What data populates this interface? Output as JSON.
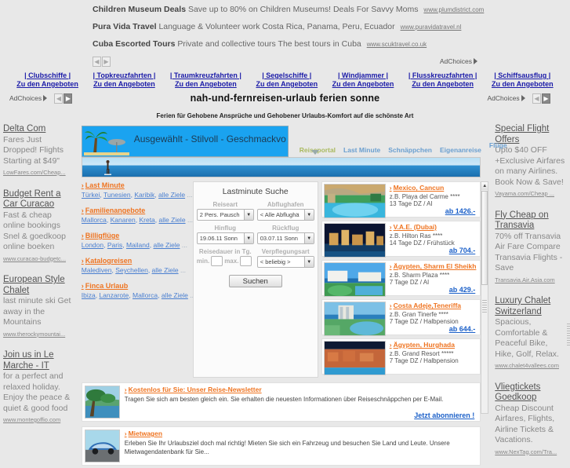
{
  "top_ads": [
    {
      "title": "Children Museum Deals",
      "text": "Save up to 80% on Children Museums! Deals For Savvy Moms",
      "url": "www.plumdistrict.com"
    },
    {
      "title": "Pura Vida Travel",
      "text": "Language & Volunteer work Costa Rica, Panama, Peru, Ecuador",
      "url": "www.puravidatravel.nl"
    },
    {
      "title": "Cuba Escorted Tours",
      "text": "Private and collective tours The best tours in Cuba",
      "url": "www.scuktravel.co.uk"
    }
  ],
  "adchoices_label": "AdChoices",
  "blue_links": [
    {
      "top": "| Clubschiffe |",
      "bottom": "Zu den Angeboten"
    },
    {
      "top": "| Topkreuzfahrten |",
      "bottom": "Zu den Angeboten"
    },
    {
      "top": "| Traumkreuzfahrten |",
      "bottom": "Zu den Angeboten"
    },
    {
      "top": "| Segelschiffe |",
      "bottom": "Zu den Angeboten"
    },
    {
      "top": "| Windjammer |",
      "bottom": "Zu den Angeboten"
    },
    {
      "top": "| Flusskreuzfahrten |",
      "bottom": "Zu den Angeboten"
    },
    {
      "top": "| Schiffsausflug |",
      "bottom": "Zu den Angeboten"
    }
  ],
  "site": {
    "title": "nah-und-fernreisen-urlaub ferien sonne",
    "subtitle": "Ferien für Gehobene Ansprüche und Gehobener Urlaubs-Komfort auf die schönste Art"
  },
  "left_sidebar": [
    {
      "heading": "Delta Com",
      "desc": "Fares Just Dropped! Flights Starting at $49\"",
      "url": "LowFares.com/Cheap..."
    },
    {
      "heading": "Budget Rent a Car Curacao",
      "desc": "Fast & cheap online bookings Snel & goedkoop online boeken",
      "url": "www.curacao-budgetc..."
    },
    {
      "heading": "European Style Chalet",
      "desc": "last minute ski Get away in the Mountains",
      "url": "www.therockymountai..."
    },
    {
      "heading": "Join us in Le Marche - IT",
      "desc": "for a perfect and relaxed holiday. Enjoy the peace & quiet & good food",
      "url": "www.montegoffio.com"
    }
  ],
  "right_sidebar": [
    {
      "heading": "Special Flight Offers",
      "desc": "Upto $40 OFF +Exclusive Airfares on many Airlines. Book Now & Save!",
      "url": "Vayama.com/Cheap  ..."
    },
    {
      "heading": "Fly Cheap on Transavia",
      "desc": "70% off Transavia Air Fare Compare Transavia Flights - Save",
      "url": "Transavia.Air.Asia.com"
    },
    {
      "heading": "Luxury Chalet Switzerland",
      "desc": "Spacious, Comfortable & Peaceful Bike, Hike, Golf, Relax.",
      "url": "www.chalet4vallees.com"
    },
    {
      "heading": "Vliegtickets Goedkoop",
      "desc": "Cheap Discount Airfares, Flights, Airline Tickets & Vacations.",
      "url": "www.NexTag.com/Tra..."
    }
  ],
  "banner": {
    "text": "Ausgewählt - Stilvoll - Geschmackvo"
  },
  "nav_tabs": [
    {
      "label": "Reiseportal",
      "active": true
    },
    {
      "label": "Last Minute",
      "active": false
    },
    {
      "label": "Schnäppchen",
      "active": false
    },
    {
      "label": "Eigenanreise",
      "active": false
    },
    {
      "label": "Flüge",
      "active": false
    }
  ],
  "left_links": [
    {
      "head": "Last Minute",
      "subs": [
        "Türkei",
        "Tunesien",
        "Karibik",
        "alle Ziele"
      ]
    },
    {
      "head": "Familienangebote",
      "subs": [
        "Mallorca",
        "Kanaren",
        "Kreta",
        "alle Ziele"
      ]
    },
    {
      "head": "Billigflüge",
      "subs": [
        "London",
        "Paris",
        "Mailand",
        "alle Ziele"
      ]
    },
    {
      "head": "Katalogreisen",
      "subs": [
        "Malediven",
        "Seychellen",
        "alle Ziele"
      ]
    },
    {
      "head": "Finca Urlaub",
      "subs": [
        "Ibiza",
        "Lanzarote",
        "Mallorca",
        "alle Ziele"
      ]
    }
  ],
  "search_form": {
    "title": "Lastminute Suche",
    "labels": {
      "reiseart": "Reiseart",
      "abflughafen": "Abflughafen",
      "hinflug": "Hinflug",
      "rueckflug": "Rückflug",
      "reisedauer": "Reisedauer in Tg.",
      "verpflegung": "Verpflegungsart",
      "min": "min.",
      "max": "max."
    },
    "values": {
      "reiseart": "2 Pers. Pausch",
      "abflughafen": "< Alle Abflughä",
      "hinflug": "19.06.11 Sonn",
      "rueckflug": "03.07.11 Sonn",
      "min": "",
      "max": "",
      "verpflegung": "< beliebig >"
    },
    "submit": "Suchen"
  },
  "offers": [
    {
      "title": "Mexico, Cancun",
      "line1": "z.B. Playa del Carme ****",
      "line2": "13 Tage DZ / AI",
      "price": "ab 1426.-"
    },
    {
      "title": "V.A.E. (Dubai)",
      "line1": "z.B. Hilton Ras ****",
      "line2": "14 Tage DZ / Frühstück",
      "price": "ab 704.-"
    },
    {
      "title": "Ägypten, Sharm El Sheikh",
      "line1": "z.B. Sharm Plaza ****",
      "line2": "7 Tage DZ / AI",
      "price": "ab 429.-"
    },
    {
      "title": "Costa Adeje,Teneriffa",
      "line1": "z.B. Gran Tinerfe ****",
      "line2": "7 Tage DZ / Halbpension",
      "price": "ab 644.-"
    },
    {
      "title": "Ägypten, Hurghada",
      "line1": "z.B. Grand Resort *****",
      "line2": "7 Tage DZ / Halbpension",
      "price": ""
    }
  ],
  "promos": [
    {
      "title": "Kostenlos für Sie: Unser Reise-Newsletter",
      "text": "Tragen Sie sich am besten gleich ein. Sie erhalten die neuesten Informationen über Reiseschnäppchen per E-Mail.",
      "cta": "Jetzt abonnieren !"
    },
    {
      "title": "Mietwagen",
      "text": "Erleben Sie Ihr Urlaubsziel doch mal richtig! Mieten Sie sich ein Fahrzeug und besuchen Sie Land und Leute. Unsere Mietwagendatenbank für Sie...",
      "cta": ""
    }
  ],
  "colors": {
    "accent_orange": "#ef7421",
    "link_blue": "#4a7fd0",
    "price_blue": "#1a5fc8",
    "nav_active": "#a9b95e",
    "banner_blue": "#1aa3f0"
  }
}
